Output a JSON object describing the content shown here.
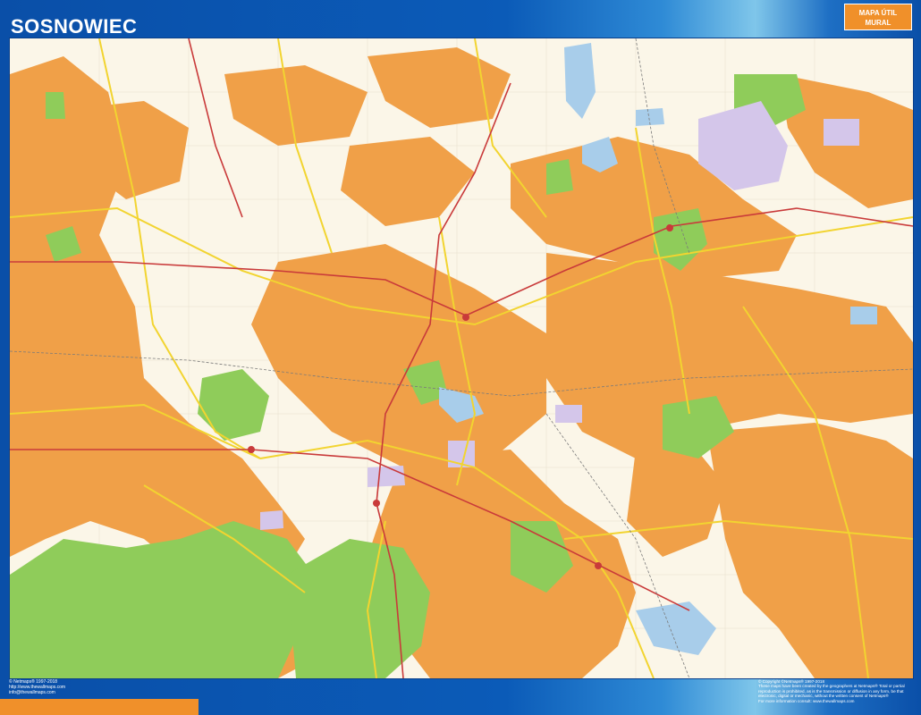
{
  "header": {
    "title": "SOSNOWIEC",
    "badge_line1": "MAPA ÚTIL",
    "badge_line2": "MURAL"
  },
  "footer_left": [
    "© Netmaps® 1997-2018",
    "http://www.thewallmaps.com",
    "info@thewallmaps.com"
  ],
  "footer_right": [
    "© Copyright ©Netmaps® 1997-2018",
    "These maps have been created by the geographers at Netmaps® Total or partial",
    "reproduction is prohibited, as is the transmission or diffusion in any form, be that",
    "electronic, digital or mechanic, without the written consent of Netmaps®",
    "For more information consult: www.thewallmaps.com"
  ],
  "colors": {
    "urban": "#f0a048",
    "park": "#8fcc5a",
    "water": "#a8cdea",
    "industrial": "#d4c6ea",
    "background": "#fbf6e8",
    "major_road": "#c93a3a",
    "road": "#f2d430",
    "frame": "#0a4fa8",
    "accent": "#f0902a"
  }
}
